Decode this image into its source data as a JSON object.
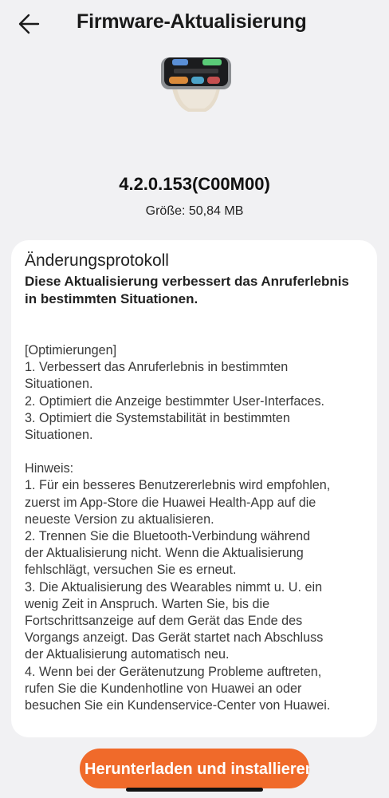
{
  "header": {
    "title": "Firmware-Aktualisierung",
    "back_icon": "arrow-left-icon"
  },
  "device": {
    "image_icon": "smartwatch-icon",
    "version": "4.2.0.153(C00M00)",
    "size": "Größe: 50,84 MB"
  },
  "changelog": {
    "title": "Änderungsprotokoll",
    "summary_lines": [
      "Diese Aktualisierung verbessert das Anruferlebnis",
      "in bestimmten Situationen."
    ],
    "body_lines": [
      "[Optimierungen]",
      "1. Verbessert das Anruferlebnis in bestimmten",
      "Situationen.",
      "2. Optimiert die Anzeige bestimmter User-Interfaces.",
      "3. Optimiert die Systemstabilität in bestimmten",
      "Situationen.",
      "",
      "Hinweis:",
      "1. Für ein besseres Benutzererlebnis wird empfohlen,",
      "zuerst im App-Store die Huawei Health-App auf die",
      "neueste Version zu aktualisieren.",
      "2. Trennen Sie die Bluetooth-Verbindung während",
      "der Aktualisierung nicht. Wenn die Aktualisierung",
      "fehlschlägt, versuchen Sie es erneut.",
      "3. Die Aktualisierung des Wearables nimmt u. U. ein",
      "wenig Zeit in Anspruch. Warten Sie, bis die",
      "Fortschrittsanzeige auf dem Gerät das Ende des",
      "Vorgangs anzeigt. Das Gerät startet nach Abschluss",
      "der Aktualisierung automatisch neu.",
      "4. Wenn bei der Gerätenutzung Probleme auftreten,",
      "rufen Sie die Kundenhotline von Huawei an oder",
      "besuchen Sie ein Kundenservice-Center von Huawei."
    ]
  },
  "actions": {
    "install_label": "Herunterladen und installieren",
    "accent_color": "#f06a2a"
  }
}
